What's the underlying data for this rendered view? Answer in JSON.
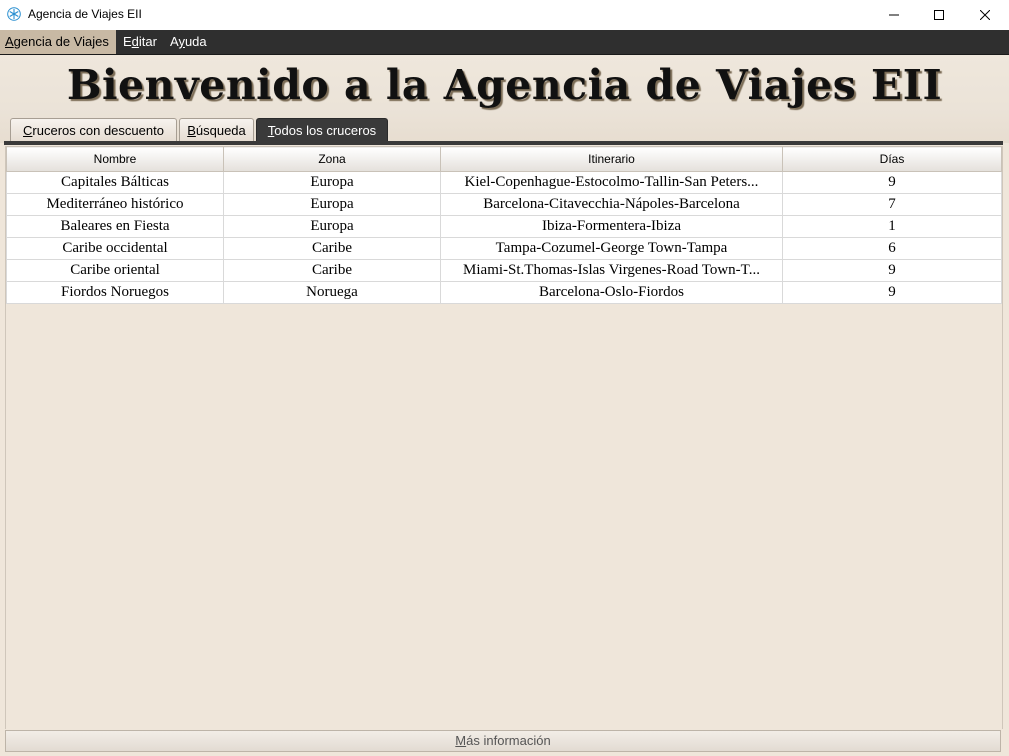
{
  "window": {
    "title": "Agencia de Viajes EII",
    "minimize_label": "─",
    "maximize_label": "☐",
    "close_label": "✕"
  },
  "menu": {
    "items": [
      {
        "label_prefix": "",
        "mnemonic": "A",
        "label_rest": "gencia de Viajes"
      },
      {
        "label_prefix": "E",
        "mnemonic": "d",
        "label_rest": "itar"
      },
      {
        "label_prefix": "A",
        "mnemonic": "y",
        "label_rest": "uda"
      }
    ]
  },
  "header": {
    "title": "Bienvenido a la Agencia de Viajes EII"
  },
  "tabs": [
    {
      "mnemonic": "C",
      "label_rest": "ruceros con descuento",
      "active": false
    },
    {
      "mnemonic": "B",
      "label_rest": "úsqueda",
      "active": false
    },
    {
      "mnemonic": "T",
      "label_rest": "odos los cruceros",
      "active": true
    }
  ],
  "table": {
    "columns": [
      "Nombre",
      "Zona",
      "Itinerario",
      "Días"
    ],
    "rows": [
      [
        "Capitales Bálticas",
        "Europa",
        "Kiel-Copenhague-Estocolmo-Tallin-San Peters...",
        "9"
      ],
      [
        "Mediterráneo histórico",
        "Europa",
        "Barcelona-Citavecchia-Nápoles-Barcelona",
        "7"
      ],
      [
        "Baleares en Fiesta",
        "Europa",
        "Ibiza-Formentera-Ibiza",
        "1"
      ],
      [
        "Caribe occidental",
        "Caribe",
        "Tampa-Cozumel-George Town-Tampa",
        "6"
      ],
      [
        "Caribe oriental",
        "Caribe",
        "Miami-St.Thomas-Islas Virgenes-Road Town-T...",
        "9"
      ],
      [
        "Fiordos Noruegos",
        "Noruega",
        "Barcelona-Oslo-Fiordos",
        "9"
      ]
    ]
  },
  "footer": {
    "more_button": {
      "mnemonic": "M",
      "label_rest": "ás información"
    }
  },
  "icons": {
    "app": "snowflake-icon",
    "minimize": "minimize-icon",
    "maximize": "maximize-icon",
    "close": "close-icon"
  },
  "colors": {
    "menubar": "#2f2f2f",
    "active_tab": "#3a3a3a",
    "background": "#efe6da",
    "app_icon": "#2a8fd0"
  }
}
